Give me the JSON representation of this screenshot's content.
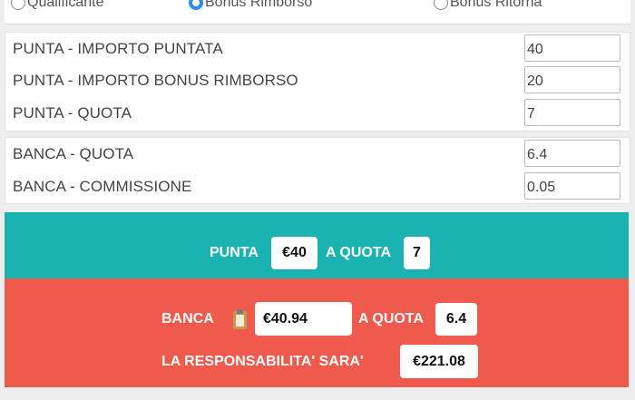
{
  "mode": {
    "options": [
      {
        "label": "Qualificante",
        "checked": false
      },
      {
        "label": "Bonus Rimborso",
        "checked": true
      },
      {
        "label": "Bonus Ritorna",
        "checked": false
      }
    ]
  },
  "punta": {
    "importo_label": "PUNTA - IMPORTO PUNTATA",
    "importo_value": "40",
    "bonus_label": "PUNTA - IMPORTO BONUS RIMBORSO",
    "bonus_value": "20",
    "quota_label": "PUNTA - QUOTA",
    "quota_value": "7"
  },
  "banca": {
    "quota_label": "BANCA - QUOTA",
    "quota_value": "6.4",
    "commissione_label": "BANCA - COMMISSIONE",
    "commissione_value": "0.05"
  },
  "result": {
    "punta_word": "PUNTA",
    "punta_amount": "€40",
    "a_quota_word": "A QUOTA",
    "punta_quota": "7",
    "banca_word": "BANCA",
    "copy_icon": "clipboard-icon",
    "banca_amount": "€40.94",
    "banca_quota": "6.4",
    "responsabilita_label": "LA RESPONSABILITA' SARA'",
    "responsabilita_value": "€221.08"
  },
  "colors": {
    "teal": "#1bb3b1",
    "red": "#ef5a4c",
    "radio_accent": "#2f8de4"
  }
}
